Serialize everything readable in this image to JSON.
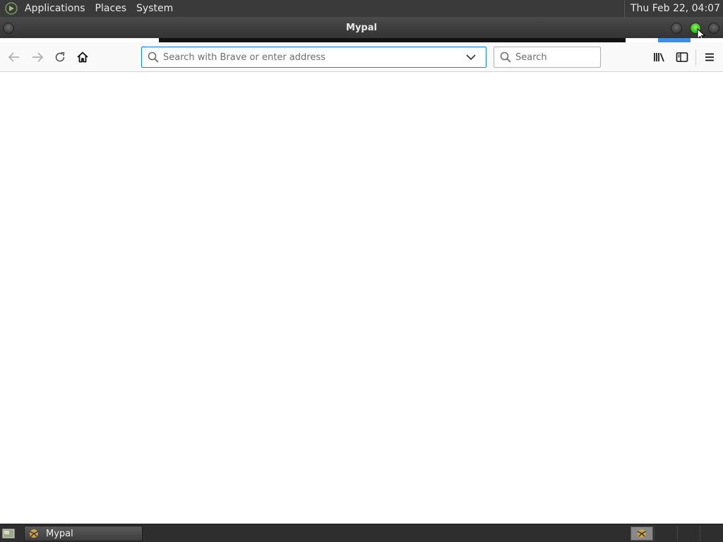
{
  "top_panel": {
    "menus": [
      "Applications",
      "Places",
      "System"
    ],
    "clock": "Thu Feb 22, 04:07"
  },
  "window": {
    "title": "Mypal"
  },
  "navbar": {
    "urlbar": {
      "placeholder": "Search with Brave or enter address",
      "value": ""
    },
    "searchbar": {
      "placeholder": "Search",
      "value": ""
    },
    "icons": [
      "back-arrow-icon",
      "forward-arrow-icon",
      "reload-icon",
      "home-icon",
      "library-icon",
      "sidebar-icon",
      "hamburger-menu-icon"
    ]
  },
  "taskbar": {
    "tasks": [
      {
        "label": "Mypal"
      }
    ]
  },
  "colors": {
    "panel": "#3a3a3a",
    "accent": "#0a84ff",
    "active_button": "#3ce02a",
    "toolbar": "#f9f9fa"
  }
}
